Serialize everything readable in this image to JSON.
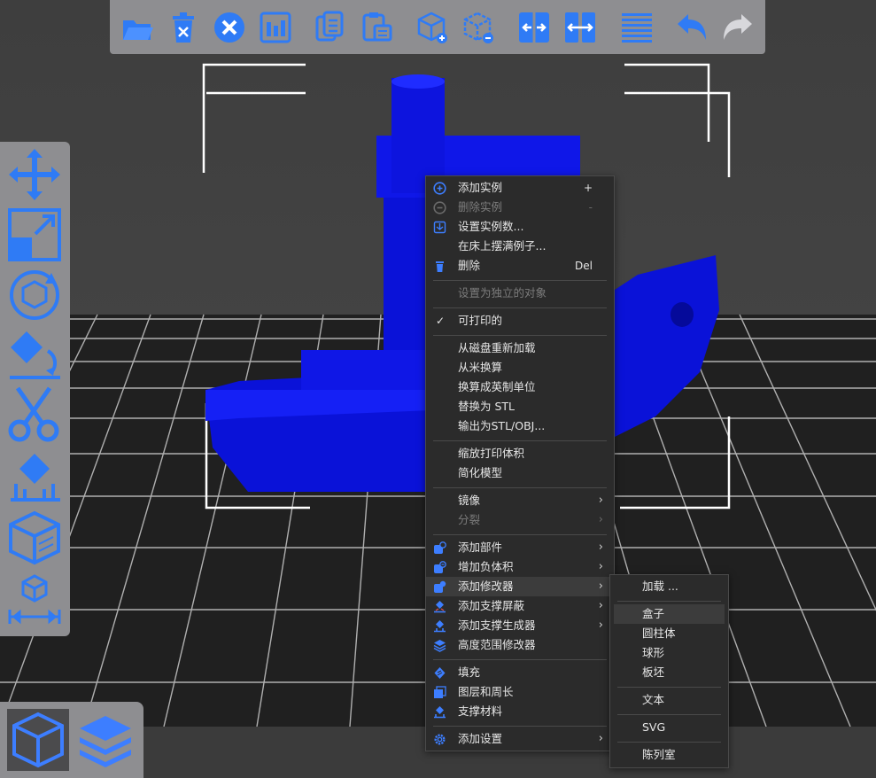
{
  "colors": {
    "accent": "#3d7eff",
    "model": "#0a12d8",
    "menu_bg": "#2b2b2b",
    "toolbar_bg": "#8e8e91"
  },
  "top_toolbar": [
    {
      "name": "open-folder-icon"
    },
    {
      "name": "delete-icon"
    },
    {
      "name": "delete-all-icon"
    },
    {
      "name": "arrange-icon"
    },
    {
      "name": "copy-icon"
    },
    {
      "name": "paste-icon"
    },
    {
      "name": "add-instance-icon"
    },
    {
      "name": "remove-instance-icon"
    },
    {
      "name": "split-objects-icon"
    },
    {
      "name": "split-parts-icon"
    },
    {
      "name": "layers-editing-icon"
    },
    {
      "name": "undo-icon"
    },
    {
      "name": "redo-icon"
    }
  ],
  "left_toolbar": [
    {
      "name": "move-icon"
    },
    {
      "name": "scale-icon"
    },
    {
      "name": "rotate-icon"
    },
    {
      "name": "place-on-face-icon"
    },
    {
      "name": "cut-icon"
    },
    {
      "name": "support-paint-icon"
    },
    {
      "name": "seam-paint-icon"
    },
    {
      "name": "measure-icon"
    }
  ],
  "view_toggle": [
    {
      "name": "3d-view-icon"
    },
    {
      "name": "preview-layers-icon"
    }
  ],
  "context_menu": {
    "items": [
      {
        "label": "添加实例",
        "shortcut": "+",
        "icon": "plus-circle-icon"
      },
      {
        "label": "删除实例",
        "shortcut": "-",
        "icon": "minus-circle-icon",
        "disabled": true
      },
      {
        "label": "设置实例数...",
        "icon": "set-number-icon"
      },
      {
        "label": "在床上摆满例子..."
      },
      {
        "label": "删除",
        "shortcut": "Del",
        "icon": "trash-icon"
      },
      {
        "label": "设置为独立的对象",
        "disabled": true
      },
      {
        "label": "可打印的",
        "checked": true
      },
      {
        "label": "从磁盘重新加载"
      },
      {
        "label": "从米换算"
      },
      {
        "label": "换算成英制单位"
      },
      {
        "label": "替换为 STL"
      },
      {
        "label": "输出为STL/OBJ..."
      },
      {
        "label": "缩放打印体积"
      },
      {
        "label": "简化模型"
      },
      {
        "label": "镜像",
        "submenu": true
      },
      {
        "label": "分裂",
        "submenu": true,
        "disabled": true
      },
      {
        "label": "添加部件",
        "submenu": true,
        "icon": "add-part-icon"
      },
      {
        "label": "增加负体积",
        "submenu": true,
        "icon": "add-negative-icon"
      },
      {
        "label": "添加修改器",
        "submenu": true,
        "icon": "add-modifier-icon"
      },
      {
        "label": "添加支撑屏蔽",
        "submenu": true,
        "icon": "support-blocker-icon"
      },
      {
        "label": "添加支撑生成器",
        "submenu": true,
        "icon": "support-enforcer-icon"
      },
      {
        "label": "高度范围修改器",
        "icon": "height-range-icon"
      },
      {
        "label": "填充",
        "icon": "infill-icon"
      },
      {
        "label": "图层和周长",
        "icon": "layers-icon"
      },
      {
        "label": "支撑材料",
        "icon": "support-material-icon"
      },
      {
        "label": "添加设置",
        "submenu": true,
        "icon": "settings-gear-icon"
      }
    ]
  },
  "submenu": {
    "items": [
      {
        "label": "加载 ..."
      },
      {
        "label": "盒子"
      },
      {
        "label": "圆柱体"
      },
      {
        "label": "球形"
      },
      {
        "label": "板坯"
      },
      {
        "label": "文本"
      },
      {
        "label": "SVG"
      },
      {
        "label": "陈列室"
      }
    ]
  }
}
